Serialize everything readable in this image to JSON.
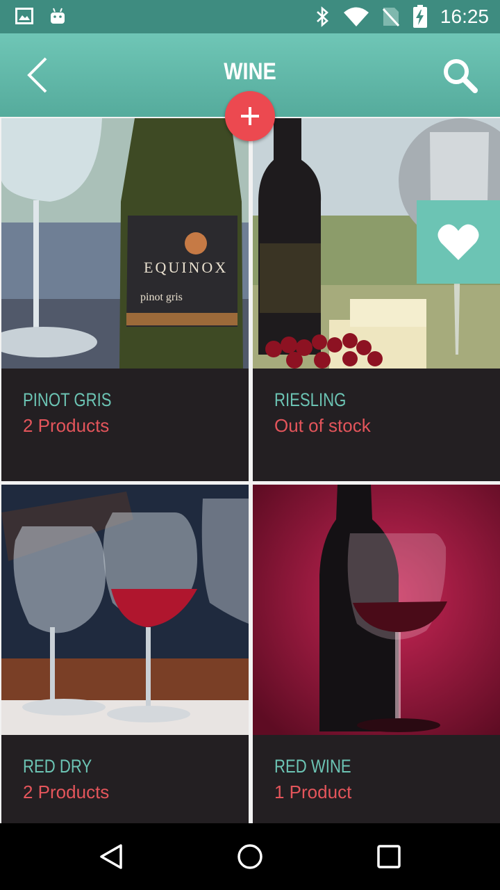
{
  "status_bar": {
    "time": "16:25"
  },
  "toolbar": {
    "title": "WINE"
  },
  "categories": [
    {
      "name": "PINOT GRIS",
      "count": "2 Products"
    },
    {
      "name": "RIESLING",
      "count": "Out of stock"
    },
    {
      "name": "RED DRY",
      "count": "2 Products"
    },
    {
      "name": "RED WINE",
      "count": "1 Product"
    }
  ],
  "colors": {
    "accent": "#6cc4b4",
    "fab": "#ec4950",
    "card_bg": "#231f22",
    "count_text": "#e4555b"
  },
  "icons": [
    "image-icon",
    "android-icon",
    "bluetooth-icon",
    "wifi-icon",
    "no-sim-icon",
    "battery-icon",
    "back-arrow-icon",
    "search-icon",
    "plus-icon",
    "heart-icon",
    "nav-back-icon",
    "nav-home-icon",
    "nav-recents-icon"
  ]
}
